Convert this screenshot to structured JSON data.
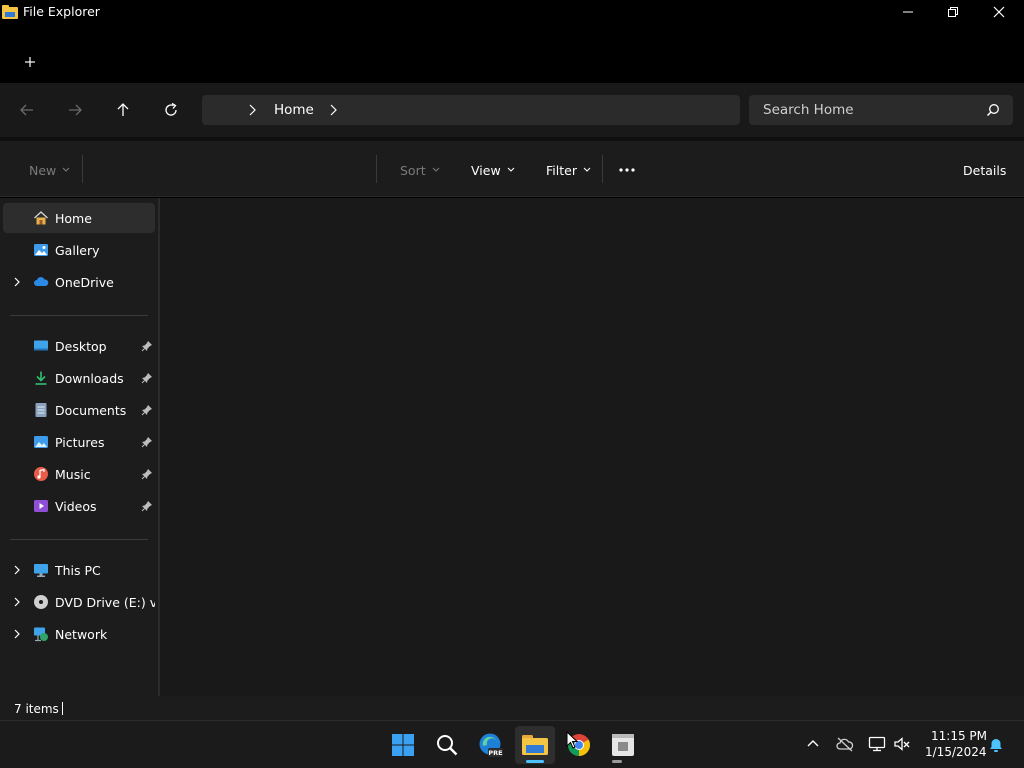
{
  "window": {
    "title": "File Explorer",
    "controls": {
      "minimize": "minimize-icon",
      "maximize": "restore-icon",
      "close": "close-icon"
    }
  },
  "tabs": {
    "new_tab_icon": "plus-icon"
  },
  "nav": {
    "back_icon": "arrow-left-icon",
    "forward_icon": "arrow-right-icon",
    "up_icon": "arrow-up-icon",
    "refresh_icon": "refresh-icon",
    "breadcrumb": [
      "Home"
    ],
    "search_placeholder": "Search Home"
  },
  "commands": {
    "new": "New",
    "sort": "Sort",
    "view": "View",
    "filter": "Filter",
    "details": "Details"
  },
  "sidebar": {
    "top": [
      {
        "label": "Home",
        "icon": "home-icon",
        "selected": true,
        "expandable": false
      },
      {
        "label": "Gallery",
        "icon": "gallery-icon",
        "selected": false,
        "expandable": false
      },
      {
        "label": "OneDrive",
        "icon": "cloud-icon",
        "selected": false,
        "expandable": true
      }
    ],
    "pinned": [
      {
        "label": "Desktop",
        "icon": "desktop-icon"
      },
      {
        "label": "Downloads",
        "icon": "download-icon"
      },
      {
        "label": "Documents",
        "icon": "document-icon"
      },
      {
        "label": "Pictures",
        "icon": "picture-icon"
      },
      {
        "label": "Music",
        "icon": "music-icon"
      },
      {
        "label": "Videos",
        "icon": "video-icon"
      }
    ],
    "drives": [
      {
        "label": "This PC",
        "icon": "pc-icon"
      },
      {
        "label": "DVD Drive (E:) virtio",
        "icon": "dvd-icon"
      },
      {
        "label": "Network",
        "icon": "network-icon"
      }
    ]
  },
  "status": {
    "items": "7 items"
  },
  "taskbar": {
    "apps": [
      "windows-start-icon",
      "search-icon",
      "edge-preview-icon",
      "file-explorer-icon",
      "chrome-icon",
      "app-icon"
    ],
    "clock_time": "11:15 PM",
    "clock_date": "1/15/2024",
    "edge_badge": "PRE"
  },
  "colors": {
    "accent": "#4cc2ff",
    "folder": "#f4c542"
  }
}
